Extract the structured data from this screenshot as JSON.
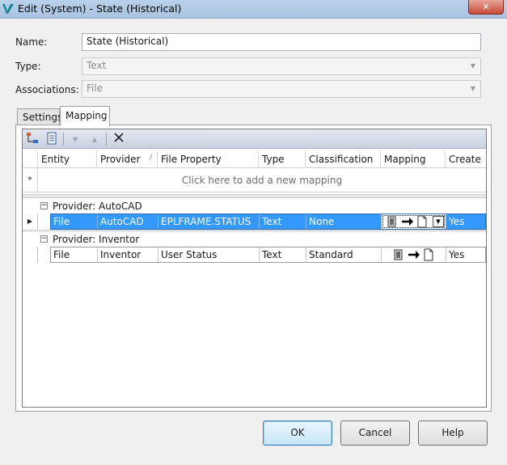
{
  "window": {
    "title": "Edit (System) - State (Historical)",
    "close_glyph": "✕"
  },
  "form": {
    "name_label": "Name:",
    "name_value": "State (Historical)",
    "type_label": "Type:",
    "type_value": "Text",
    "associations_label": "Associations:",
    "associations_value": "File"
  },
  "tabs": [
    {
      "label": "Settings",
      "active": false
    },
    {
      "label": "Mapping",
      "active": true
    }
  ],
  "toolbar": {
    "icons": [
      "add-mapping-icon",
      "properties-icon",
      "move-down-icon",
      "move-up-icon",
      "delete-icon"
    ]
  },
  "grid": {
    "columns": [
      "Entity",
      "Provider",
      "File Property",
      "Type",
      "Classification",
      "Mapping",
      "Create"
    ],
    "add_row_star": "*",
    "add_row_text": "Click here to add a new mapping",
    "groups": [
      {
        "label": "Provider: AutoCAD",
        "toggle": "−",
        "rows": [
          {
            "entity": "File",
            "provider": "AutoCAD",
            "file_property": "EPLFRAME.STATUS",
            "type": "Text",
            "classification": "None",
            "create": "Yes",
            "selected": true
          }
        ]
      },
      {
        "label": "Provider: Inventor",
        "toggle": "−",
        "rows": [
          {
            "entity": "File",
            "provider": "Inventor",
            "file_property": "User Status",
            "type": "Text",
            "classification": "Standard",
            "create": "Yes",
            "selected": false
          }
        ]
      }
    ]
  },
  "buttons": {
    "ok": "OK",
    "cancel": "Cancel",
    "help": "Help"
  },
  "colors": {
    "selection": "#3399ff",
    "title_bar": "#b9d1ea"
  }
}
